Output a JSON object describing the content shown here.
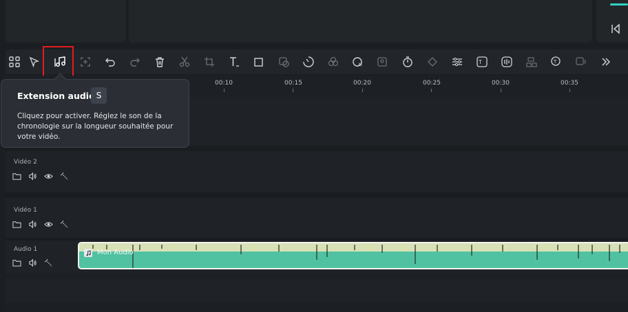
{
  "tooltip": {
    "title": "Extension audio",
    "shortcut": "S",
    "description": "Cliquez pour activer. Réglez le son de la chronologie sur la longueur souhaitée pour votre vidéo."
  },
  "toolbar": {
    "items": [
      "grid-icon",
      "select-arrow-icon",
      "audio-stretch-icon",
      "add-marker-icon",
      "undo-icon",
      "redo-icon",
      "delete-icon",
      "cut-icon",
      "crop-icon",
      "text-icon",
      "shape-icon",
      "mask-icon",
      "speed-icon",
      "color-icon",
      "ai-audio-icon",
      "ai-portrait-icon",
      "timer-icon",
      "keyframe-icon",
      "adjust-icon",
      "ai-text-icon",
      "audio-wave-icon",
      "split-audio-icon",
      "tts-icon",
      "voice-icon",
      "more-icon"
    ]
  },
  "ruler": {
    "labels": [
      "00:10",
      "00:15",
      "00:20",
      "00:25",
      "00:30",
      "00:35"
    ]
  },
  "tracks": {
    "video2": "Vidéo 2",
    "video1": "Vidéo 1",
    "audio1": "Audio 1"
  },
  "clip": {
    "label": "Mon Audio"
  }
}
